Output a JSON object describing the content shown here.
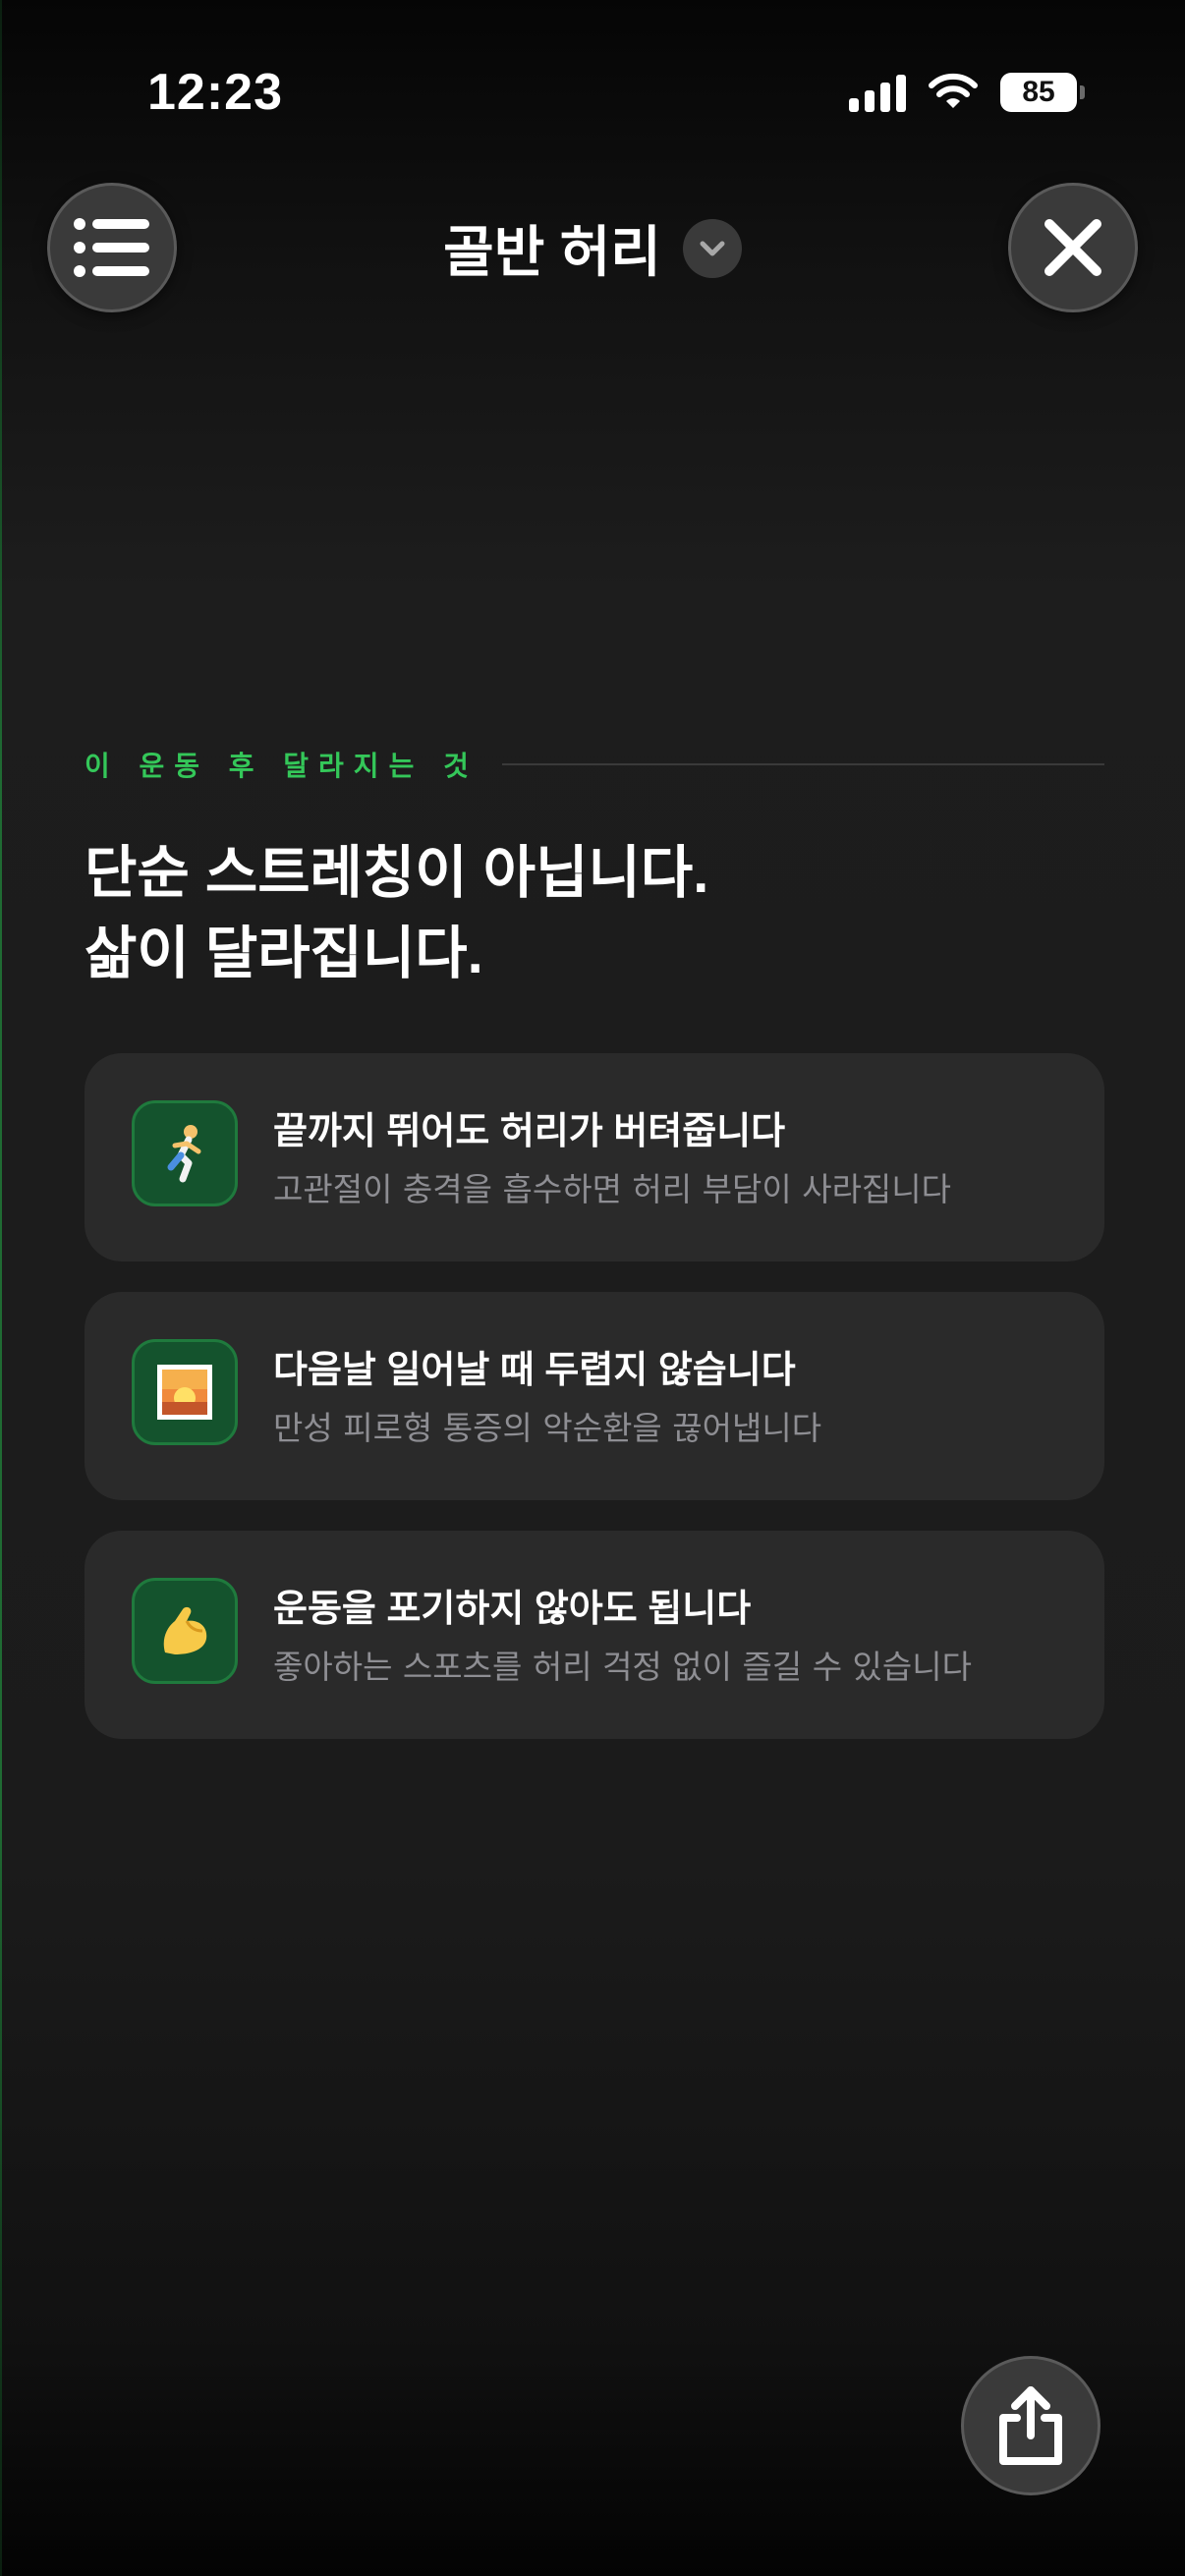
{
  "status_bar": {
    "time": "12:23",
    "battery": "85"
  },
  "header": {
    "title": "골반 허리",
    "menu_icon": "list-icon",
    "close_icon": "close-icon",
    "dropdown_icon": "chevron-down-icon"
  },
  "section": {
    "label": "이 운동 후 달라지는 것",
    "headline_line1": "단순 스트레칭이 아닙니다.",
    "headline_line2": "삶이 달라집니다."
  },
  "cards": [
    {
      "icon": "running-person-icon",
      "title": "끝까지 뛰어도 허리가 버텨줍니다",
      "description": "고관절이 충격을 흡수하면 허리 부담이 사라집니다"
    },
    {
      "icon": "sunrise-icon",
      "title": "다음날 일어날 때 두렵지 않습니다",
      "description": "만성 피로형 통증의 악순환을 끊어냅니다"
    },
    {
      "icon": "flexed-biceps-icon",
      "title": "운동을 포기하지 않아도 됩니다",
      "description": "좋아하는 스포츠를 허리 걱정 없이 즐길 수 있습니다"
    }
  ],
  "share_icon": "share-icon",
  "colors": {
    "accent_green": "#34c759",
    "card_background": "#2a2a2a",
    "icon_tile": "#14532d"
  }
}
